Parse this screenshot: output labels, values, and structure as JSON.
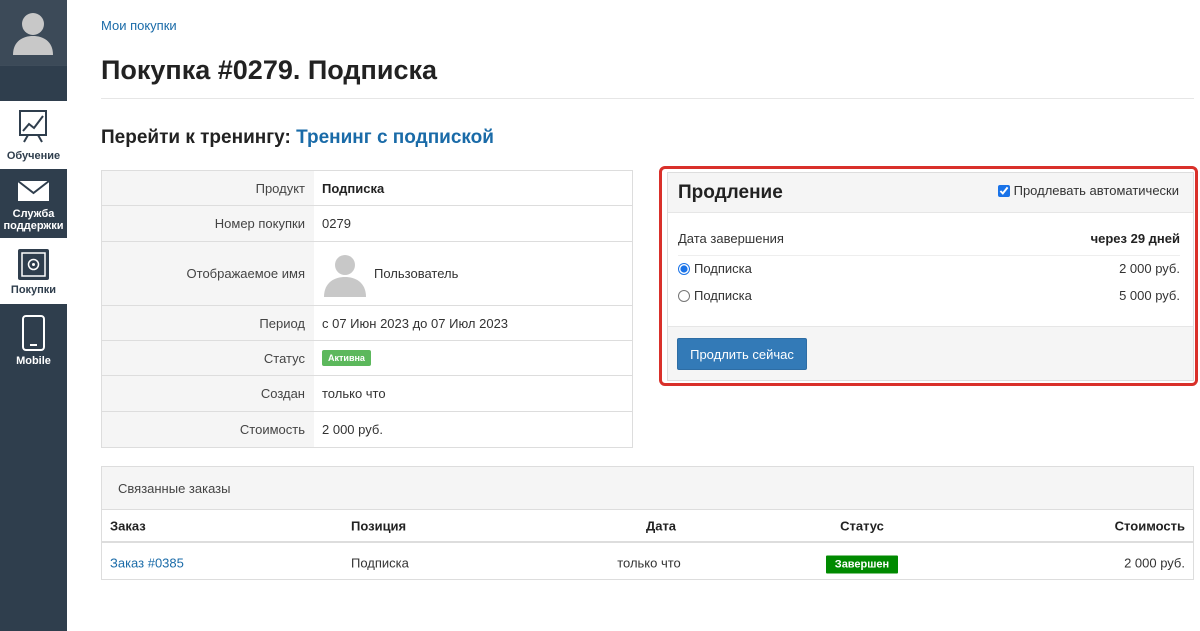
{
  "sidebar": {
    "items": [
      {
        "label": "Обучение",
        "icon": "chart-board-icon"
      },
      {
        "label": "Служба поддержки",
        "icon": "envelope-icon"
      },
      {
        "label": "Покупки",
        "icon": "safe-icon"
      },
      {
        "label": "Mobile",
        "icon": "phone-icon"
      }
    ]
  },
  "breadcrumb": "Мои покупки",
  "page_title": "Покупка #0279. Подписка",
  "training": {
    "prefix": "Перейти к тренингу:",
    "link": "Тренинг с подпиской"
  },
  "info": {
    "product_label": "Продукт",
    "product_value": "Подписка",
    "number_label": "Номер покупки",
    "number_value": "0279",
    "display_name_label": "Отображаемое имя",
    "display_name_value": "Пользователь",
    "period_label": "Период",
    "period_value": "с 07 Июн 2023 до 07 Июл 2023",
    "status_label": "Статус",
    "status_value": "Активна",
    "created_label": "Создан",
    "created_value": "только что",
    "cost_label": "Стоимость",
    "cost_value": "2 000 руб."
  },
  "renewal": {
    "title": "Продление",
    "auto_label": "Продлевать автоматически",
    "auto_checked": true,
    "end_label": "Дата завершения",
    "end_value": "через 29 дней",
    "options": [
      {
        "label": "Подписка",
        "price": "2 000 руб.",
        "selected": true
      },
      {
        "label": "Подписка",
        "price": "5 000 руб.",
        "selected": false
      }
    ],
    "button": "Продлить сейчас"
  },
  "orders": {
    "title": "Связанные заказы",
    "columns": {
      "order": "Заказ",
      "position": "Позиция",
      "date": "Дата",
      "status": "Статус",
      "cost": "Стоимость"
    },
    "rows": [
      {
        "order": "Заказ #0385",
        "position": "Подписка",
        "date": "только что",
        "status": "Завершен",
        "cost": "2 000 руб."
      }
    ]
  },
  "colors": {
    "sidebar": "#2f3e4d",
    "link": "#1a6ba8",
    "active_badge": "#5cb85c",
    "done_badge": "#008a00",
    "highlight": "#d9302a",
    "button": "#337ab7"
  }
}
